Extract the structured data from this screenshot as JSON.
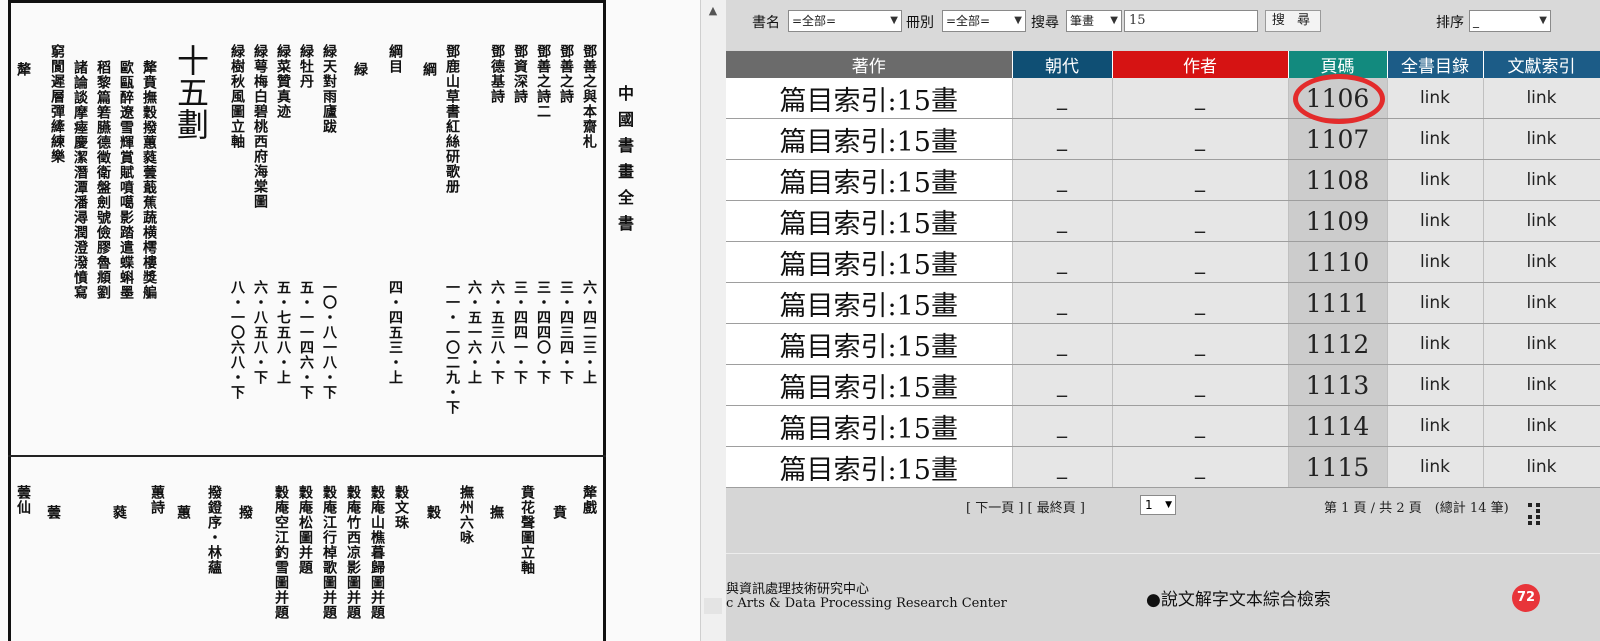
{
  "scan": {
    "book_title": "中國書畫全書",
    "section_heading": "十五劃",
    "upper_columns": [
      "鄧善之與本齋札",
      "鄧善之詩",
      "鄧善之詩二",
      "鄧資深詩",
      "鄧德基詩",
      "鄧鹿山草書紅絲研歌册",
      "綱",
      "綱目",
      "緑",
      "緑天對雨廬跋",
      "緑牡丹",
      "緑菜贊真迹",
      "緑萼梅白碧桃西府海棠圖",
      "緑樹秋風圖立軸",
      "十五劃",
      "犛",
      "窮閬遲層彈縴練樂"
    ],
    "upper_pages": [
      "六・四二三・上",
      "三・四三四・下",
      "三・四四〇・下",
      "三・四四一・下",
      "六・五三八・下",
      "六・五一六・上",
      "一一・一〇二九・下",
      "四・四五三・上",
      "一〇・八一八・下",
      "五・一一四六・下",
      "五・七五八・上",
      "六・八五八・下",
      "八・一〇六八・下"
    ],
    "upper_chars": [
      "犛賁撫穀撥蕙蕤蕓蕺蕉蔬横樗樓獎艑",
      "歐甌醉遼雪輝賞賦噴噶影踏遣蝶蝌墨",
      "稻黎篇箬臙德徵衛盤劍號儉膠魯頫劉",
      "諸論談摩瘞慶潔潛潭潘潯潤澄潑憤寫"
    ],
    "lower_columns": [
      "犛戲",
      "賁",
      "賁花聲圖立軸",
      "撫",
      "撫州六咏",
      "穀",
      "穀文珠",
      "穀庵山樵暮歸圖并題",
      "穀庵竹西凉影圖并題",
      "穀庵江行棹歌圖并題",
      "穀庵松圖并題",
      "穀庵空江釣雪圖并題",
      "撥",
      "撥鐙序・林蘊",
      "蕙",
      "蕙詩",
      "蕤",
      "蕓",
      "蕓仙"
    ]
  },
  "toolbar": {
    "book_label": "書名",
    "book_value": "=全部=",
    "volume_label": "冊別",
    "volume_value": "=全部=",
    "search_label": "搜尋",
    "search_type": "筆畫",
    "search_query": "15",
    "search_button": "搜 尋",
    "sort_label": "排序",
    "sort_value": "_"
  },
  "table": {
    "headers": [
      "著作",
      "朝代",
      "作者",
      "頁碼",
      "全書目錄",
      "文獻索引"
    ],
    "header_colors": [
      "#6b6b6b",
      "#0f4f74",
      "#d61313",
      "#128a7e",
      "#1c5c87",
      "#1c5c87"
    ],
    "rows": [
      {
        "work": "篇目索引:15畫",
        "dynasty": "_",
        "author": "_",
        "page": "1106",
        "toc": "link",
        "index": "link"
      },
      {
        "work": "篇目索引:15畫",
        "dynasty": "_",
        "author": "_",
        "page": "1107",
        "toc": "link",
        "index": "link"
      },
      {
        "work": "篇目索引:15畫",
        "dynasty": "_",
        "author": "_",
        "page": "1108",
        "toc": "link",
        "index": "link"
      },
      {
        "work": "篇目索引:15畫",
        "dynasty": "_",
        "author": "_",
        "page": "1109",
        "toc": "link",
        "index": "link"
      },
      {
        "work": "篇目索引:15畫",
        "dynasty": "_",
        "author": "_",
        "page": "1110",
        "toc": "link",
        "index": "link"
      },
      {
        "work": "篇目索引:15畫",
        "dynasty": "_",
        "author": "_",
        "page": "1111",
        "toc": "link",
        "index": "link"
      },
      {
        "work": "篇目索引:15畫",
        "dynasty": "_",
        "author": "_",
        "page": "1112",
        "toc": "link",
        "index": "link"
      },
      {
        "work": "篇目索引:15畫",
        "dynasty": "_",
        "author": "_",
        "page": "1113",
        "toc": "link",
        "index": "link"
      },
      {
        "work": "篇目索引:15畫",
        "dynasty": "_",
        "author": "_",
        "page": "1114",
        "toc": "link",
        "index": "link"
      },
      {
        "work": "篇目索引:15畫",
        "dynasty": "_",
        "author": "_",
        "page": "1115",
        "toc": "link",
        "index": "link"
      }
    ]
  },
  "pager": {
    "nav_links": "[ 下一頁 ] [ 最終頁 ]",
    "page_select": "1",
    "status": "第 1 頁 / 共 2 頁　(總計 14 筆)"
  },
  "footer": {
    "line1": "與資訊處理技術研究中心",
    "line2": "c Arts & Data Processing Research Center",
    "link": "●說文解字文本綜合檢索",
    "badge_text": "72"
  },
  "accent_colors": {
    "highlight_ring": "#e32b2b"
  }
}
